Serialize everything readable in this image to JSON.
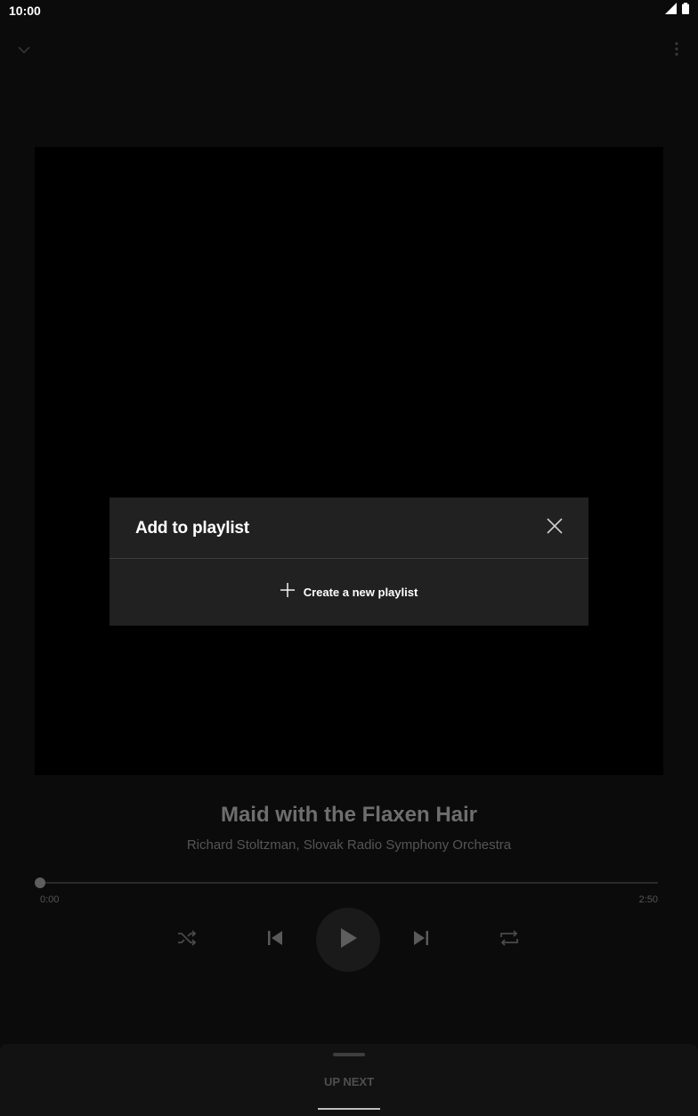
{
  "status_bar": {
    "time": "10:00",
    "icons": [
      "signal-icon",
      "battery-icon"
    ]
  },
  "top_bar": {
    "collapse_icon": "chevron-down-icon",
    "menu_icon": "more-vert-icon"
  },
  "dialog": {
    "title": "Add to playlist",
    "close_icon": "close-icon",
    "create_label": "Create a new playlist",
    "create_icon": "plus-icon"
  },
  "now_playing": {
    "title": "Maid with the Flaxen Hair",
    "artist": "Richard Stoltzman, Slovak Radio Symphony Orchestra",
    "time_current": "0:00",
    "time_total": "2:50",
    "progress": 0
  },
  "controls": {
    "shuffle_icon": "shuffle-icon",
    "previous_icon": "skip-previous-icon",
    "play_icon": "play-icon",
    "next_icon": "skip-next-icon",
    "repeat_icon": "repeat-icon"
  },
  "up_next": {
    "label": "UP NEXT"
  },
  "colors": {
    "background": "#0b0b0b",
    "dialog": "#212121",
    "artwork": "#000000",
    "muted_text": "#6e6e6e"
  }
}
